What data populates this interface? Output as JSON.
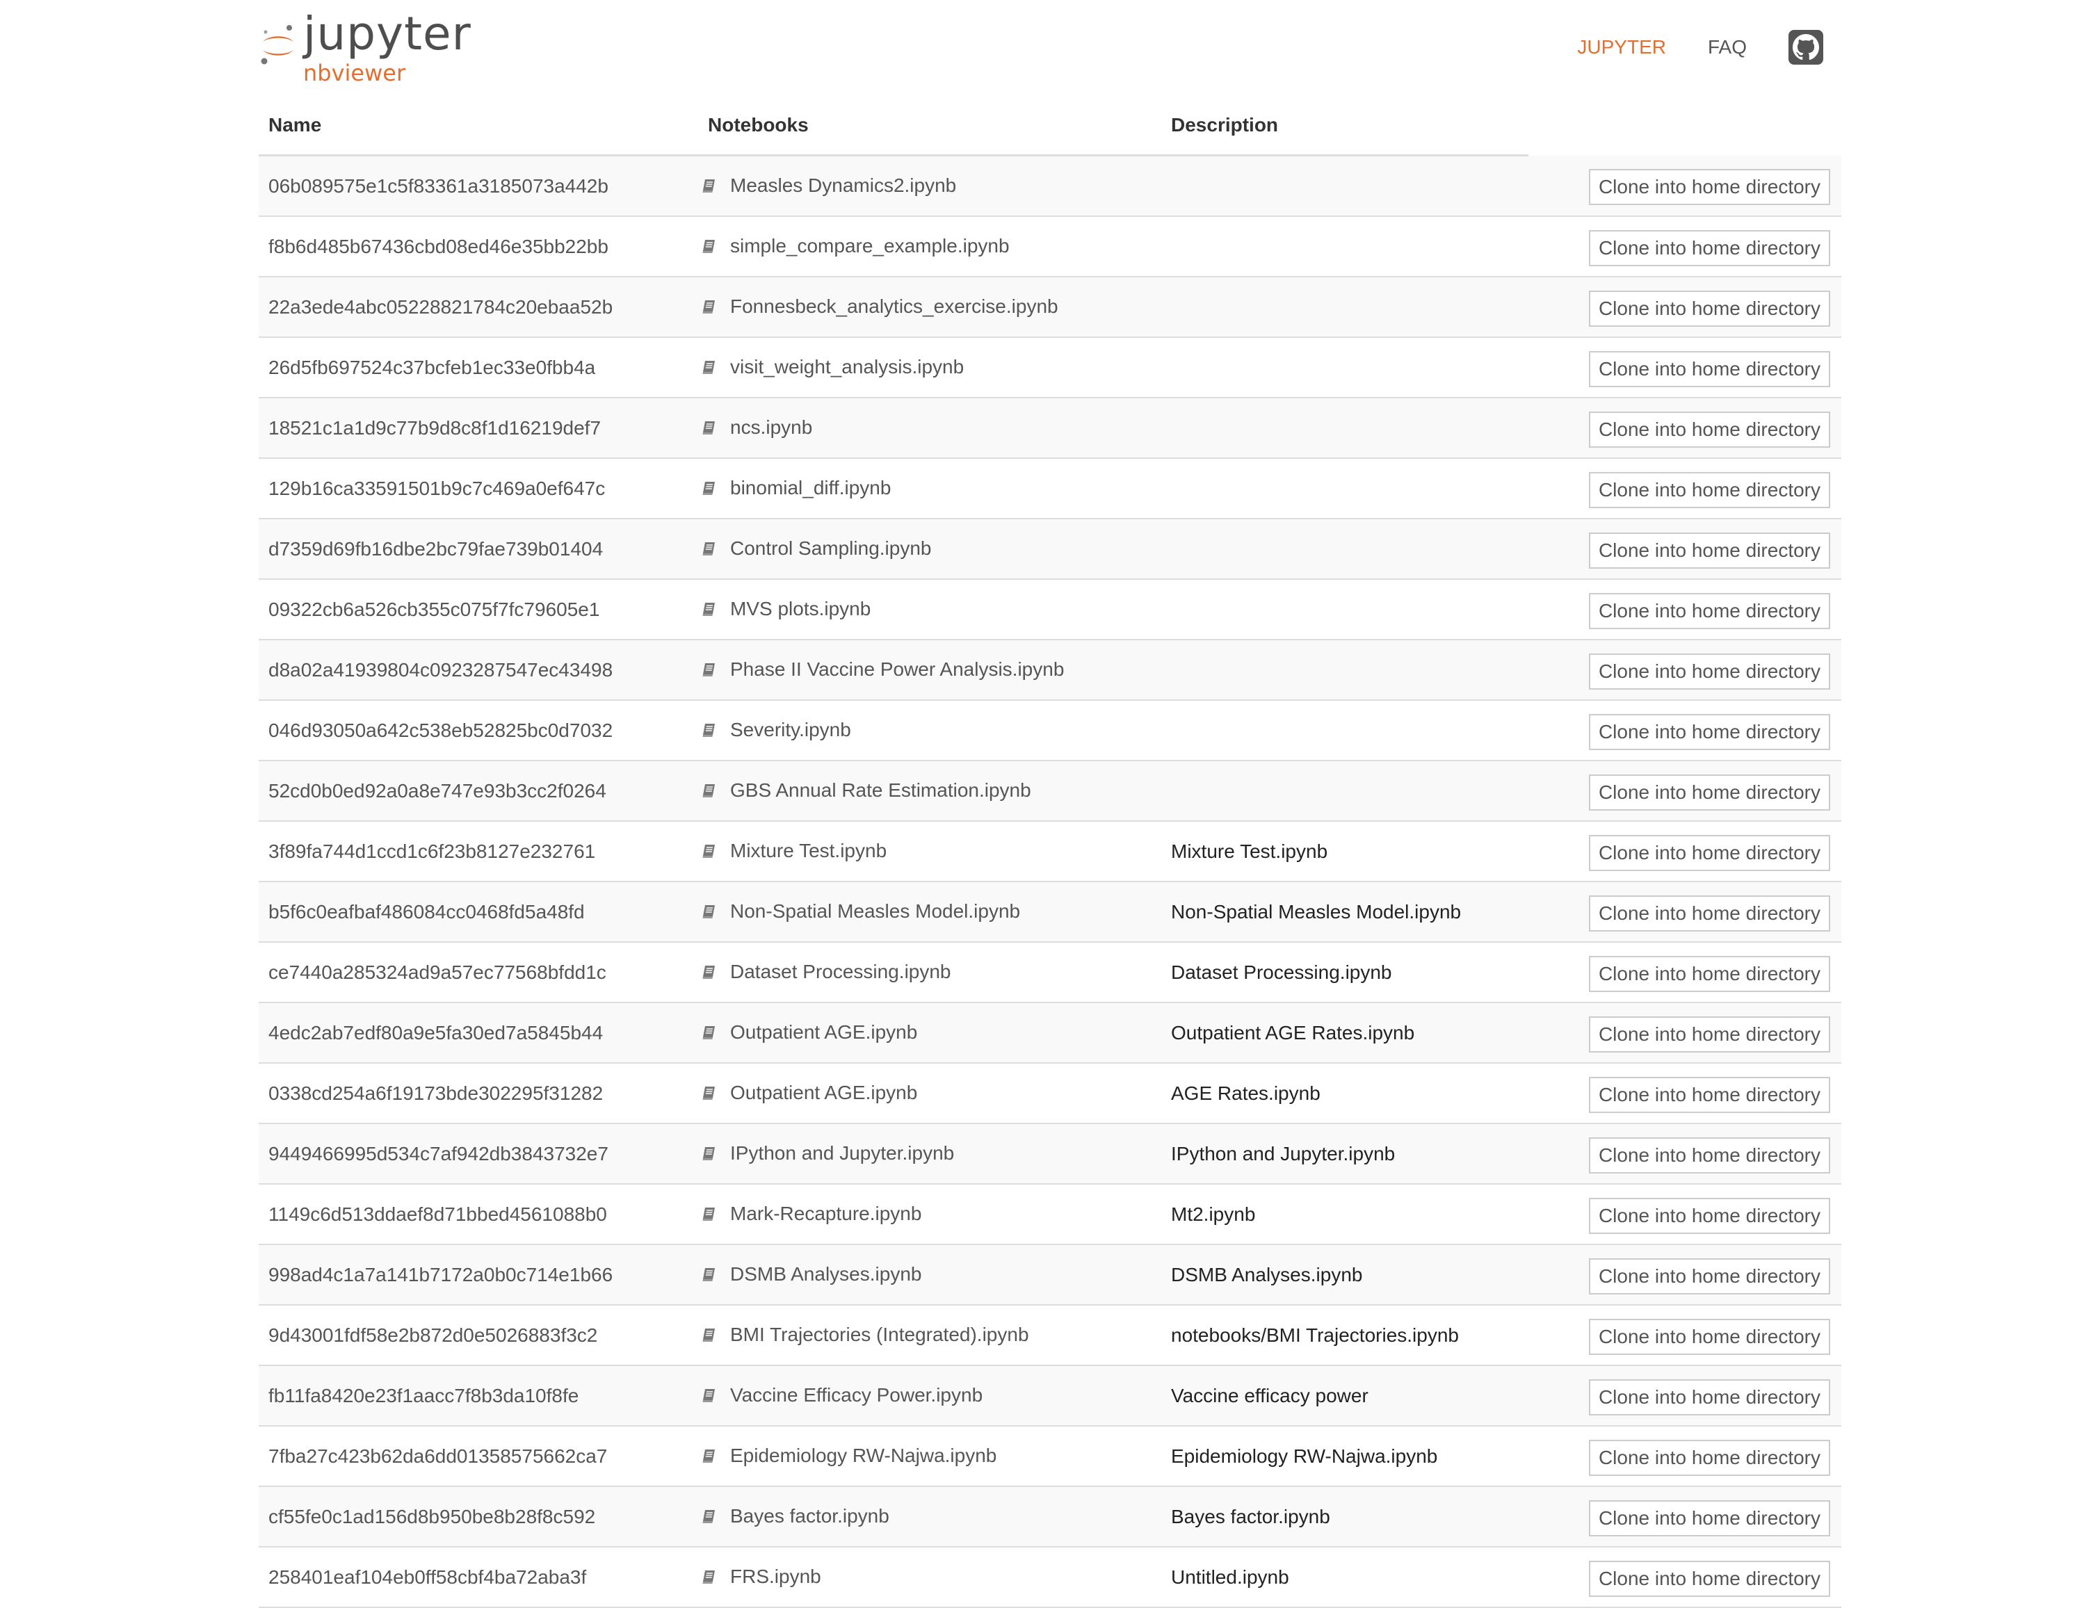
{
  "header": {
    "logo_word": "jupyter",
    "logo_sub": "nbviewer",
    "nav": [
      {
        "label": "JUPYTER",
        "active": true
      },
      {
        "label": "FAQ",
        "active": false
      }
    ],
    "github_icon": "github-icon"
  },
  "colors": {
    "accent": "#e46e2e",
    "text": "#555555",
    "border": "#dddddd"
  },
  "table": {
    "columns": [
      "Name",
      "Notebooks",
      "Description"
    ],
    "button_label": "Clone into home directory",
    "rows": [
      {
        "name": "06b089575e1c5f83361a3185073a442b",
        "notebook": "Measles Dynamics2.ipynb",
        "description": ""
      },
      {
        "name": "f8b6d485b67436cbd08ed46e35bb22bb",
        "notebook": "simple_compare_example.ipynb",
        "description": ""
      },
      {
        "name": "22a3ede4abc05228821784c20ebaa52b",
        "notebook": "Fonnesbeck_analytics_exercise.ipynb",
        "description": ""
      },
      {
        "name": "26d5fb697524c37bcfeb1ec33e0fbb4a",
        "notebook": "visit_weight_analysis.ipynb",
        "description": ""
      },
      {
        "name": "18521c1a1d9c77b9d8c8f1d16219def7",
        "notebook": "ncs.ipynb",
        "description": ""
      },
      {
        "name": "129b16ca33591501b9c7c469a0ef647c",
        "notebook": "binomial_diff.ipynb",
        "description": ""
      },
      {
        "name": "d7359d69fb16dbe2bc79fae739b01404",
        "notebook": "Control Sampling.ipynb",
        "description": ""
      },
      {
        "name": "09322cb6a526cb355c075f7fc79605e1",
        "notebook": "MVS plots.ipynb",
        "description": ""
      },
      {
        "name": "d8a02a41939804c0923287547ec43498",
        "notebook": "Phase II Vaccine Power Analysis.ipynb",
        "description": ""
      },
      {
        "name": "046d93050a642c538eb52825bc0d7032",
        "notebook": "Severity.ipynb",
        "description": ""
      },
      {
        "name": "52cd0b0ed92a0a8e747e93b3cc2f0264",
        "notebook": "GBS Annual Rate Estimation.ipynb",
        "description": ""
      },
      {
        "name": "3f89fa744d1ccd1c6f23b8127e232761",
        "notebook": "Mixture Test.ipynb",
        "description": "Mixture Test.ipynb"
      },
      {
        "name": "b5f6c0eafbaf486084cc0468fd5a48fd",
        "notebook": "Non-Spatial Measles Model.ipynb",
        "description": "Non-Spatial Measles Model.ipynb"
      },
      {
        "name": "ce7440a285324ad9a57ec77568bfdd1c",
        "notebook": "Dataset Processing.ipynb",
        "description": "Dataset Processing.ipynb"
      },
      {
        "name": "4edc2ab7edf80a9e5fa30ed7a5845b44",
        "notebook": "Outpatient AGE.ipynb",
        "description": "Outpatient AGE Rates.ipynb"
      },
      {
        "name": "0338cd254a6f19173bde302295f31282",
        "notebook": "Outpatient AGE.ipynb",
        "description": "AGE Rates.ipynb"
      },
      {
        "name": "9449466995d534c7af942db3843732e7",
        "notebook": "IPython and Jupyter.ipynb",
        "description": "IPython and Jupyter.ipynb"
      },
      {
        "name": "1149c6d513ddaef8d71bbed4561088b0",
        "notebook": "Mark-Recapture.ipynb",
        "description": "Mt2.ipynb"
      },
      {
        "name": "998ad4c1a7a141b7172a0b0c714e1b66",
        "notebook": "DSMB Analyses.ipynb",
        "description": "DSMB Analyses.ipynb"
      },
      {
        "name": "9d43001fdf58e2b872d0e5026883f3c2",
        "notebook": "BMI Trajectories (Integrated).ipynb",
        "description": "notebooks/BMI Trajectories.ipynb"
      },
      {
        "name": "fb11fa8420e23f1aacc7f8b3da10f8fe",
        "notebook": "Vaccine Efficacy Power.ipynb",
        "description": "Vaccine efficacy power"
      },
      {
        "name": "7fba27c423b62da6dd01358575662ca7",
        "notebook": "Epidemiology RW-Najwa.ipynb",
        "description": "Epidemiology RW-Najwa.ipynb"
      },
      {
        "name": "cf55fe0c1ad156d8b950be8b28f8c592",
        "notebook": "Bayes factor.ipynb",
        "description": "Bayes factor.ipynb"
      },
      {
        "name": "258401eaf104eb0ff58cbf4ba72aba3f",
        "notebook": "FRS.ipynb",
        "description": "Untitled.ipynb"
      }
    ]
  }
}
